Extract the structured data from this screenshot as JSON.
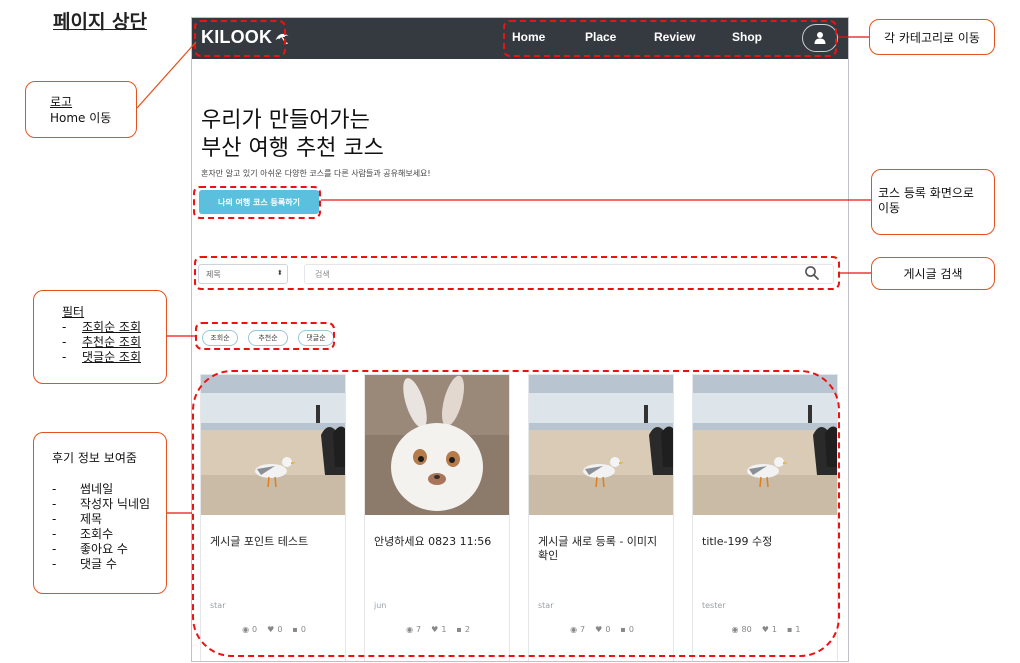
{
  "page_title": "페이지 상단",
  "navbar": {
    "logo_text": "KILOOK",
    "links": [
      "Home",
      "Place",
      "Review",
      "Shop"
    ]
  },
  "hero": {
    "line1": "우리가 만들어가는",
    "line2": "부산 여행 추천 코스",
    "description": "혼자만 알고 있기 아쉬운 다양한 코스를 다른 사람들과 공유해보세요!",
    "register_button": "나의 여행 코스 등록하기"
  },
  "search": {
    "select_value": "제목",
    "placeholder": "검색"
  },
  "filters": [
    "조회순",
    "추천순",
    "댓글순"
  ],
  "cards": [
    {
      "title": "게시글 포인트 테스트",
      "author": "star",
      "views": "0",
      "likes": "0",
      "comments": "0",
      "image": "seagull-beach"
    },
    {
      "title": "안녕하세요 0823 11:56",
      "author": "jun",
      "views": "7",
      "likes": "1",
      "comments": "2",
      "image": "white-rabbit"
    },
    {
      "title": "게시글 새로 등록 - 이미지 확인",
      "author": "star",
      "views": "7",
      "likes": "0",
      "comments": "0",
      "image": "seagull-beach"
    },
    {
      "title": "title-199 수정",
      "author": "tester",
      "views": "80",
      "likes": "1",
      "comments": "1",
      "image": "seagull-beach"
    }
  ],
  "annotations": {
    "logo": {
      "line1": "로고",
      "line2": "Home 이동"
    },
    "category": "각 카테고리로 이동",
    "register": "코스 등록 화면으로 이동",
    "search": "게시글 검색",
    "filter": {
      "title": "필터",
      "items": [
        "조회순 조회",
        "추천순 조회",
        "댓글순 조회"
      ]
    },
    "review": {
      "title": "후기 정보 보여줌",
      "items": [
        "썸네일",
        "작성자 닉네임",
        "제목",
        "조회수",
        "좋아요 수",
        "댓글 수"
      ]
    }
  },
  "colors": {
    "navbar": "#343a40",
    "accent_button": "#5bc0de",
    "annotation_border": "#e4531e",
    "dashed_highlight": "#e11111"
  }
}
